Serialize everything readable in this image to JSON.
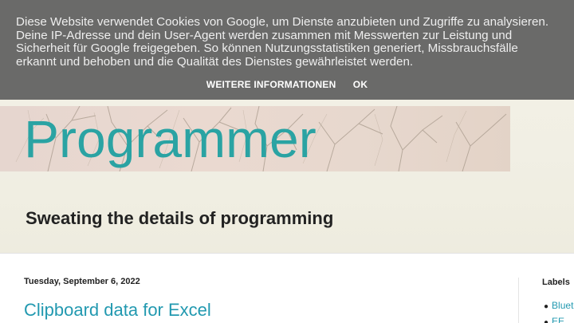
{
  "cookie_banner": {
    "text": "Diese Website verwendet Cookies von Google, um Dienste anzubieten und Zugriffe zu analysieren. Deine IP-Adresse und dein User-Agent werden zusammen mit Messwerten zur Leistung und Sicherheit für Google freigegeben. So können Nutzungsstatistiken generiert, Missbrauchsfälle erkannt und behoben und die Qualität des Dienstes gewährleistet werden.",
    "more_info_label": "WEITERE INFORMATIONEN",
    "ok_label": "OK"
  },
  "header": {
    "title": "Programmer",
    "description": "Sweating the details of programming"
  },
  "main": {
    "date": "Tuesday, September 6, 2022",
    "post_title": "Clipboard data for Excel"
  },
  "sidebar": {
    "title": "Labels",
    "items": [
      {
        "label": "Bluetooth"
      },
      {
        "label": "EE"
      }
    ]
  },
  "colors": {
    "accent": "#2aa3a3",
    "link": "#2299b0",
    "banner_bg": "#646464"
  }
}
